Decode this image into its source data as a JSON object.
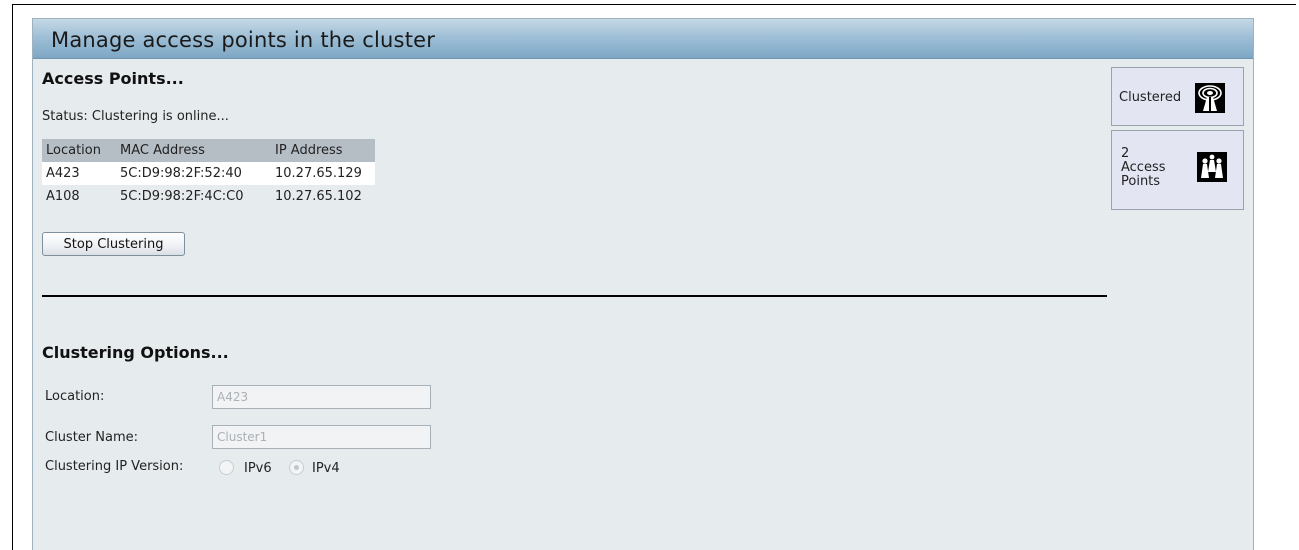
{
  "header": {
    "title": "Manage access points in the cluster"
  },
  "access_points": {
    "section_title": "Access Points...",
    "status": "Status: Clustering is online...",
    "table": {
      "columns": [
        "Location",
        "MAC Address",
        "IP Address"
      ],
      "rows": [
        [
          "A423",
          "5C:D9:98:2F:52:40",
          "10.27.65.129"
        ],
        [
          "A108",
          "5C:D9:98:2F:4C:C0",
          "10.27.65.102"
        ]
      ]
    },
    "stop_button_label": "Stop Clustering"
  },
  "clustering_options": {
    "section_title": "Clustering Options...",
    "location_label": "Location:",
    "location_value": "A423",
    "cluster_name_label": "Cluster Name:",
    "cluster_name_value": "Cluster1",
    "ip_version_label": "Clustering IP Version:",
    "ip_version_options": [
      {
        "label": "IPv6",
        "selected": false
      },
      {
        "label": "IPv4",
        "selected": true
      }
    ]
  },
  "sidebar": {
    "clustered_label": "Clustered",
    "clustered_icon": "wireless-tower-icon",
    "ap_count": "2",
    "ap_count_label_line1": "Access",
    "ap_count_label_line2": "Points",
    "ap_icon": "access-points-group-icon"
  },
  "colors": {
    "header_gradient_top": "#c6d9e6",
    "header_gradient_bottom": "#7ea7c5",
    "panel_background": "#e6ebee",
    "table_header": "#b6bec5",
    "side_box": "#e3e6f2"
  }
}
